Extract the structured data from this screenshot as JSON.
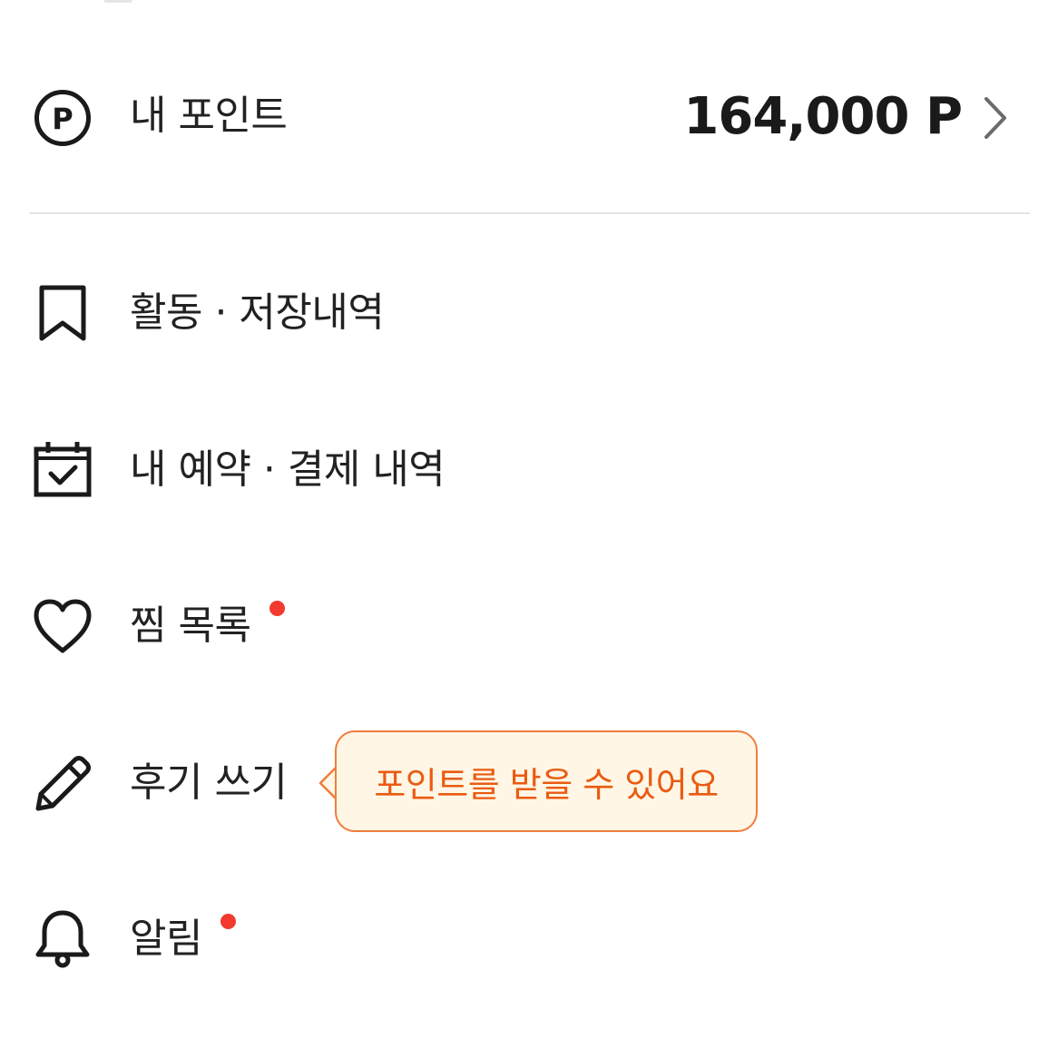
{
  "points": {
    "label": "내 포인트",
    "value": "164,000 P",
    "icon": "points-icon"
  },
  "menu": {
    "activity": {
      "label": "활동 · 저장내역",
      "icon": "bookmark-icon"
    },
    "reservations": {
      "label": "내 예약 · 결제 내역",
      "icon": "calendar-check-icon"
    },
    "wishlist": {
      "label": "찜 목록",
      "icon": "heart-icon",
      "has_new": true
    },
    "review": {
      "label": "후기 쓰기",
      "icon": "pencil-icon"
    },
    "notifications": {
      "label": "알림",
      "icon": "bell-icon",
      "has_new": true
    }
  },
  "review_tooltip": {
    "text": "포인트를 받을 수 있어요"
  },
  "colors": {
    "text": "#222222",
    "divider": "#e4e4e4",
    "badge_dot": "#f23a2f",
    "tooltip_border": "#f07d3c",
    "tooltip_bg": "#fff6e5",
    "tooltip_text": "#ea5b12"
  }
}
